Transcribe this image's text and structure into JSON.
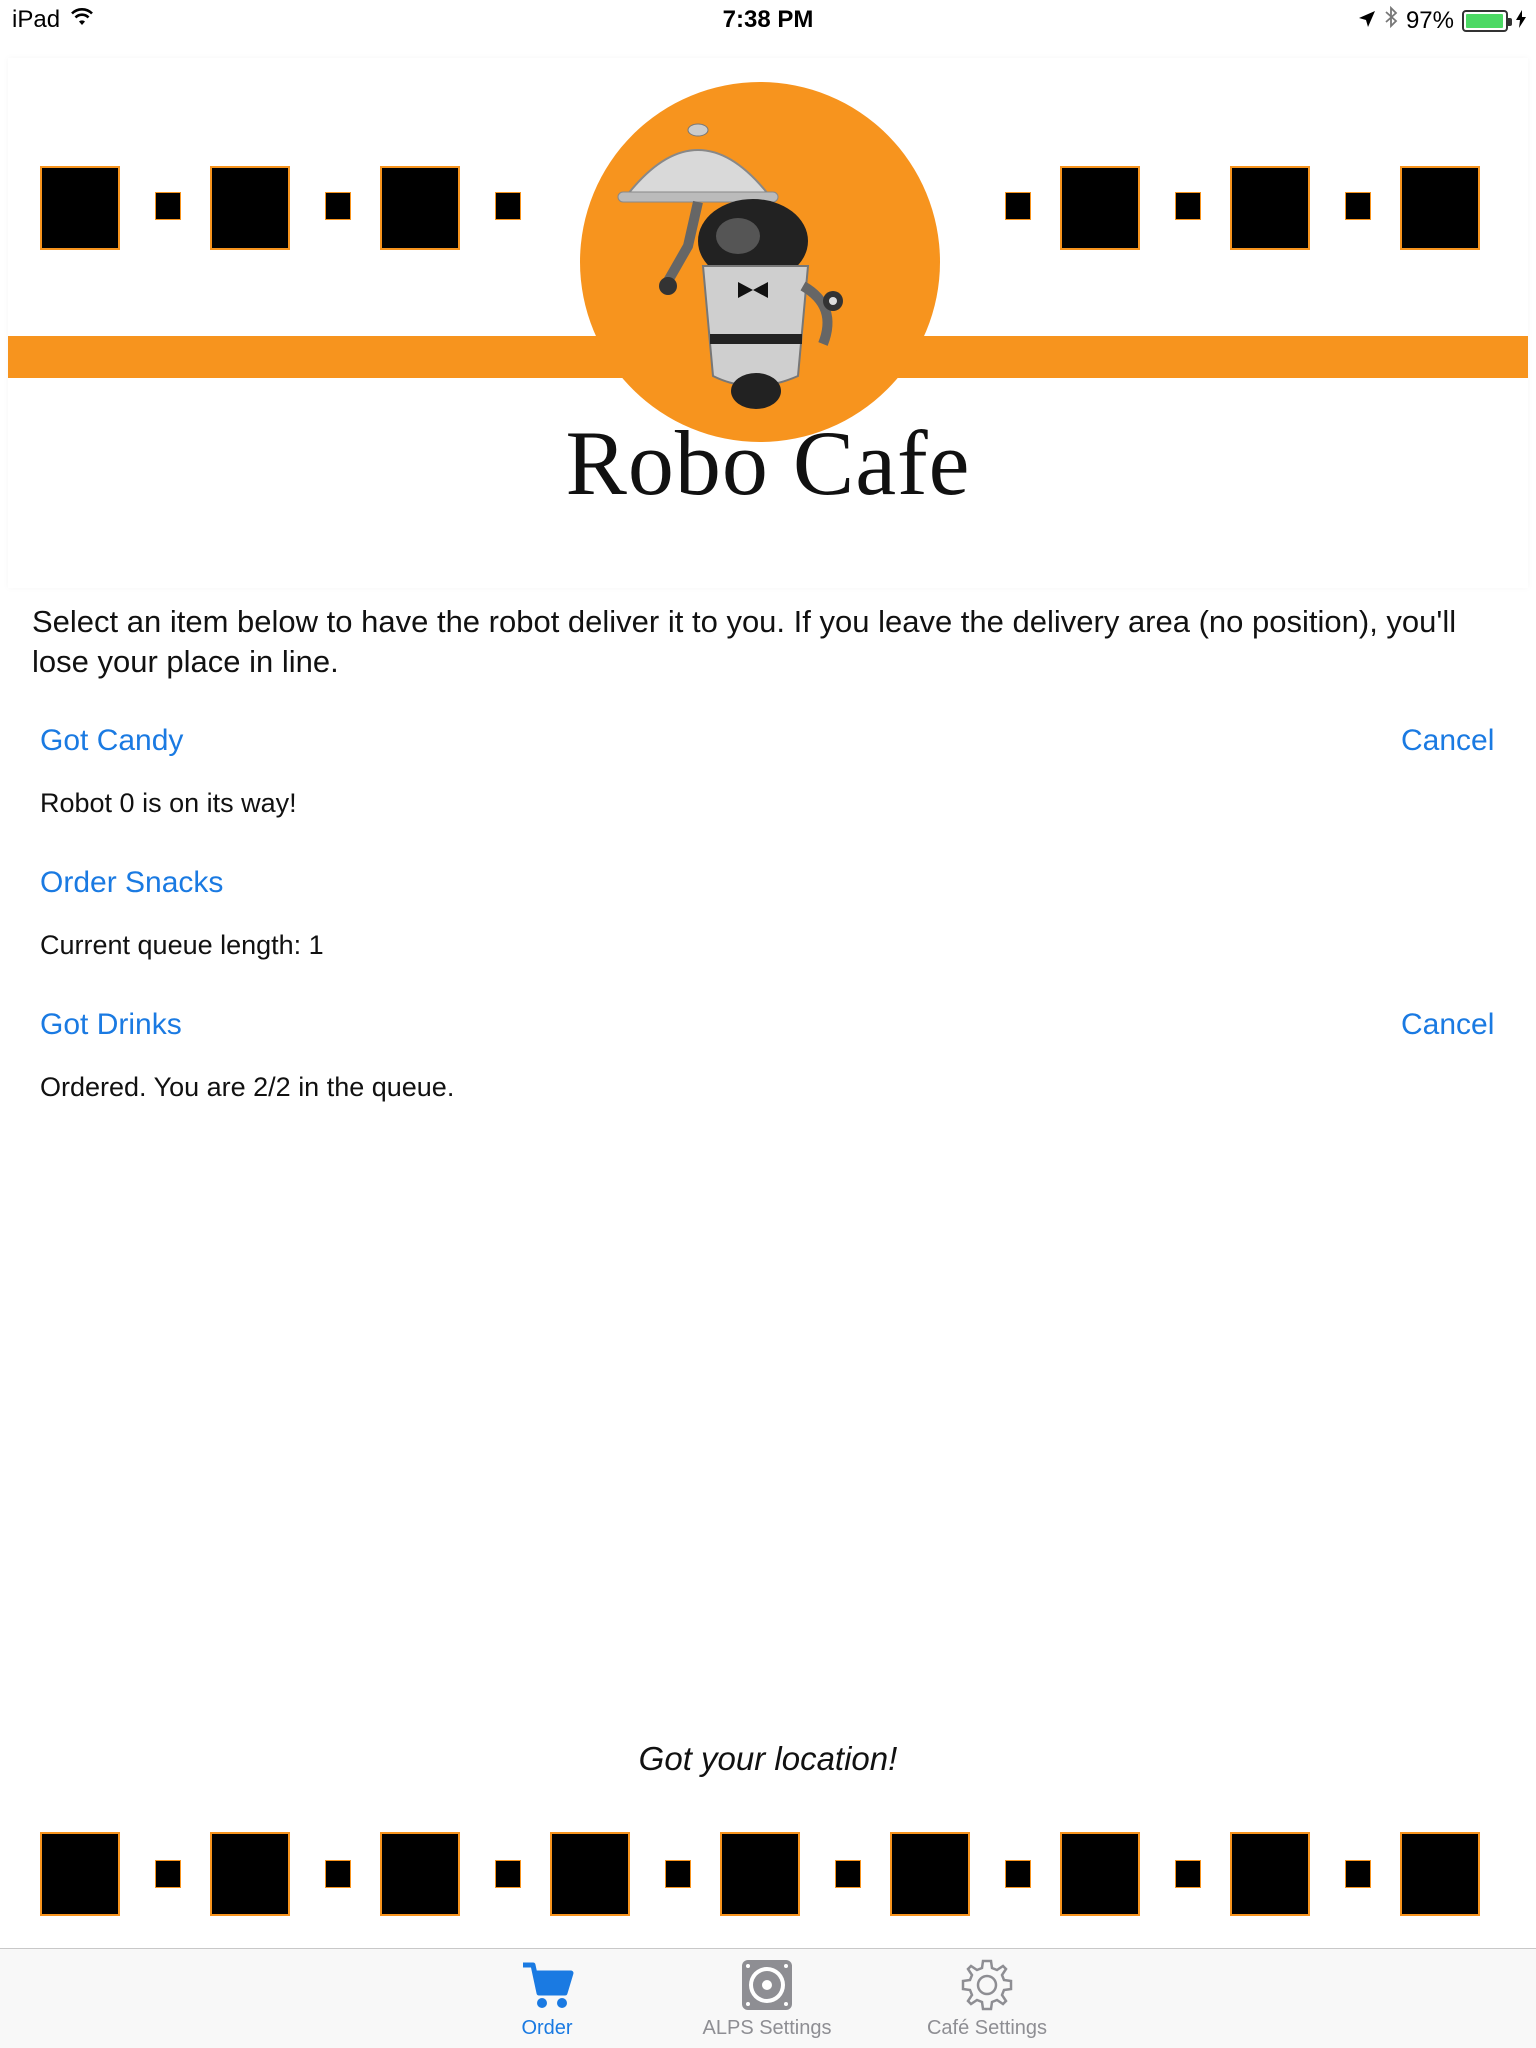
{
  "status_bar": {
    "device": "iPad",
    "time": "7:38 PM",
    "battery": "97%",
    "battery_level": 0.97,
    "icons": [
      "wifi-icon",
      "location-arrow-icon",
      "bluetooth-icon",
      "battery-icon",
      "charging-icon"
    ]
  },
  "header": {
    "logo_title": "Robo Cafe",
    "colors": {
      "orange": "#f7941e",
      "black": "#000000"
    }
  },
  "main": {
    "instructions": "Select an item below to have the robot deliver it to you. If you leave the delivery area (no position), you'll lose your place in line.",
    "orders": [
      {
        "label": "Got Candy",
        "cancel_label": "Cancel",
        "status": "Robot 0 is on its way!"
      },
      {
        "label": "Order Snacks",
        "cancel_label": "",
        "status": "Current queue length: 1"
      },
      {
        "label": "Got Drinks",
        "cancel_label": "Cancel",
        "status": "Ordered. You are 2/2 in the queue."
      }
    ],
    "location_message": "Got your location!"
  },
  "tab_bar": {
    "tabs": [
      {
        "label": "Order",
        "icon": "cart-icon",
        "active": true
      },
      {
        "label": "ALPS Settings",
        "icon": "speaker-icon",
        "active": false
      },
      {
        "label": "Café Settings",
        "icon": "gear-icon",
        "active": false
      }
    ],
    "accent": "#1a7ae2"
  }
}
